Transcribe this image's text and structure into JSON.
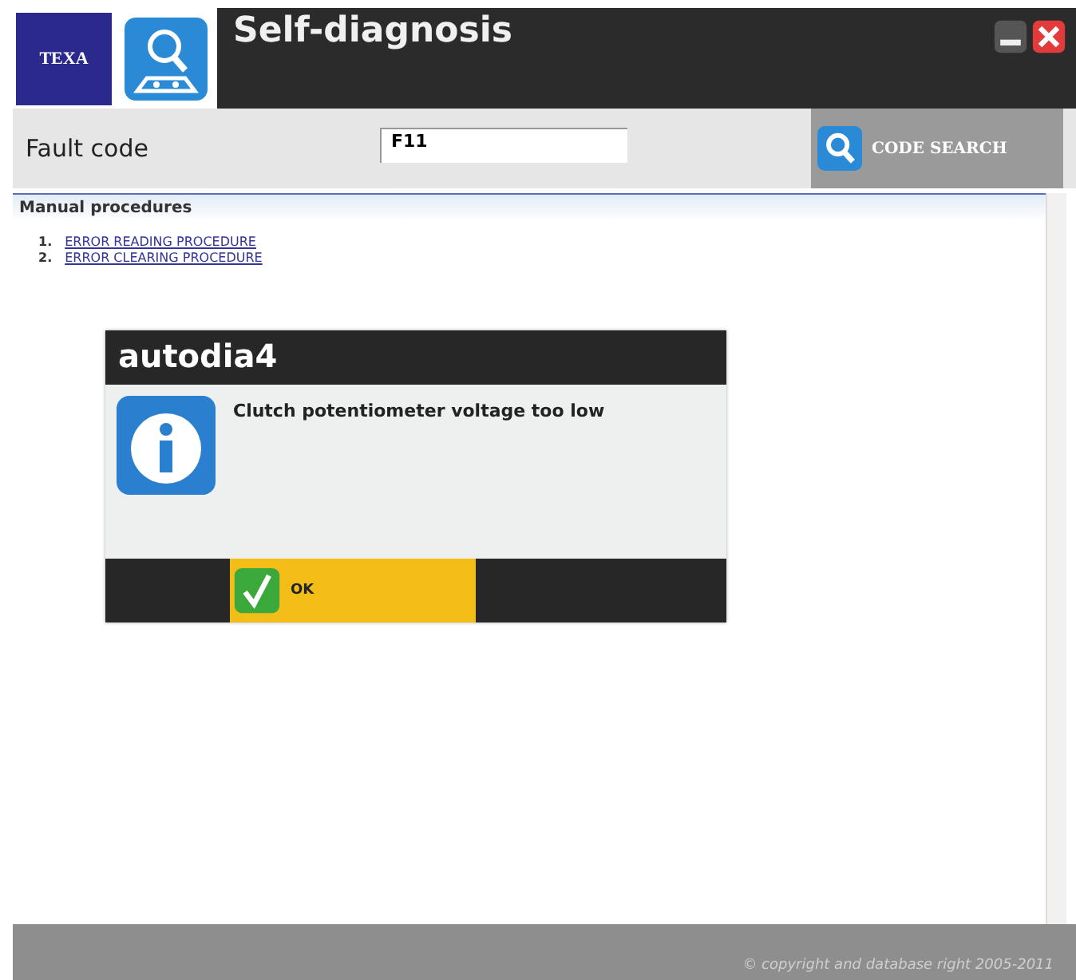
{
  "window": {
    "logo": "TEXA",
    "title": "Self-diagnosis"
  },
  "search": {
    "label": "Fault code",
    "value": "F11",
    "button": "CODE SEARCH"
  },
  "section": {
    "title": "Manual procedures",
    "items": [
      {
        "number": "1.",
        "label": "ERROR READING PROCEDURE"
      },
      {
        "number": "2.",
        "label": "ERROR CLEARING PROCEDURE"
      }
    ]
  },
  "dialog": {
    "title": "autodia4",
    "message": "Clutch potentiometer voltage too low",
    "button": "OK"
  },
  "status_bar": {
    "text": "© copyright and database right 2005-2011"
  }
}
